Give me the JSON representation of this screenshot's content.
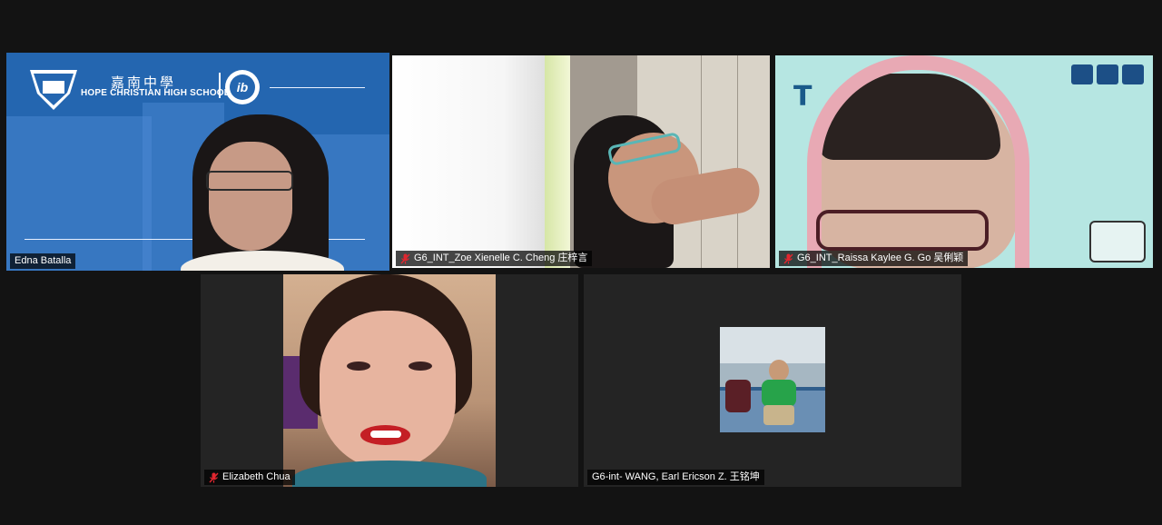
{
  "participants": [
    {
      "name": "Edna Batalla",
      "muted": false,
      "active_speaker": true,
      "background": {
        "school_name_cn": "嘉南中學",
        "school_name_en": "HOPE CHRISTIAN HIGH SCHOOL",
        "ib_mark": "ib"
      }
    },
    {
      "name": "G6_INT_Zoe Xienelle C. Cheng 庄梓言",
      "muted": true,
      "active_speaker": false
    },
    {
      "name": "G6_INT_Raissa Kaylee G. Go 吴俐颖",
      "muted": true,
      "active_speaker": false
    },
    {
      "name": "Elizabeth Chua",
      "muted": true,
      "active_speaker": false
    },
    {
      "name": "G6-int- WANG, Earl Ericson Z. 王铭坤",
      "muted": false,
      "active_speaker": false,
      "video_off": true
    }
  ],
  "colors": {
    "background": "#131313",
    "active_speaker_border": "#dff280",
    "muted_icon": "#e0262f",
    "tile_empty": "#242424"
  }
}
